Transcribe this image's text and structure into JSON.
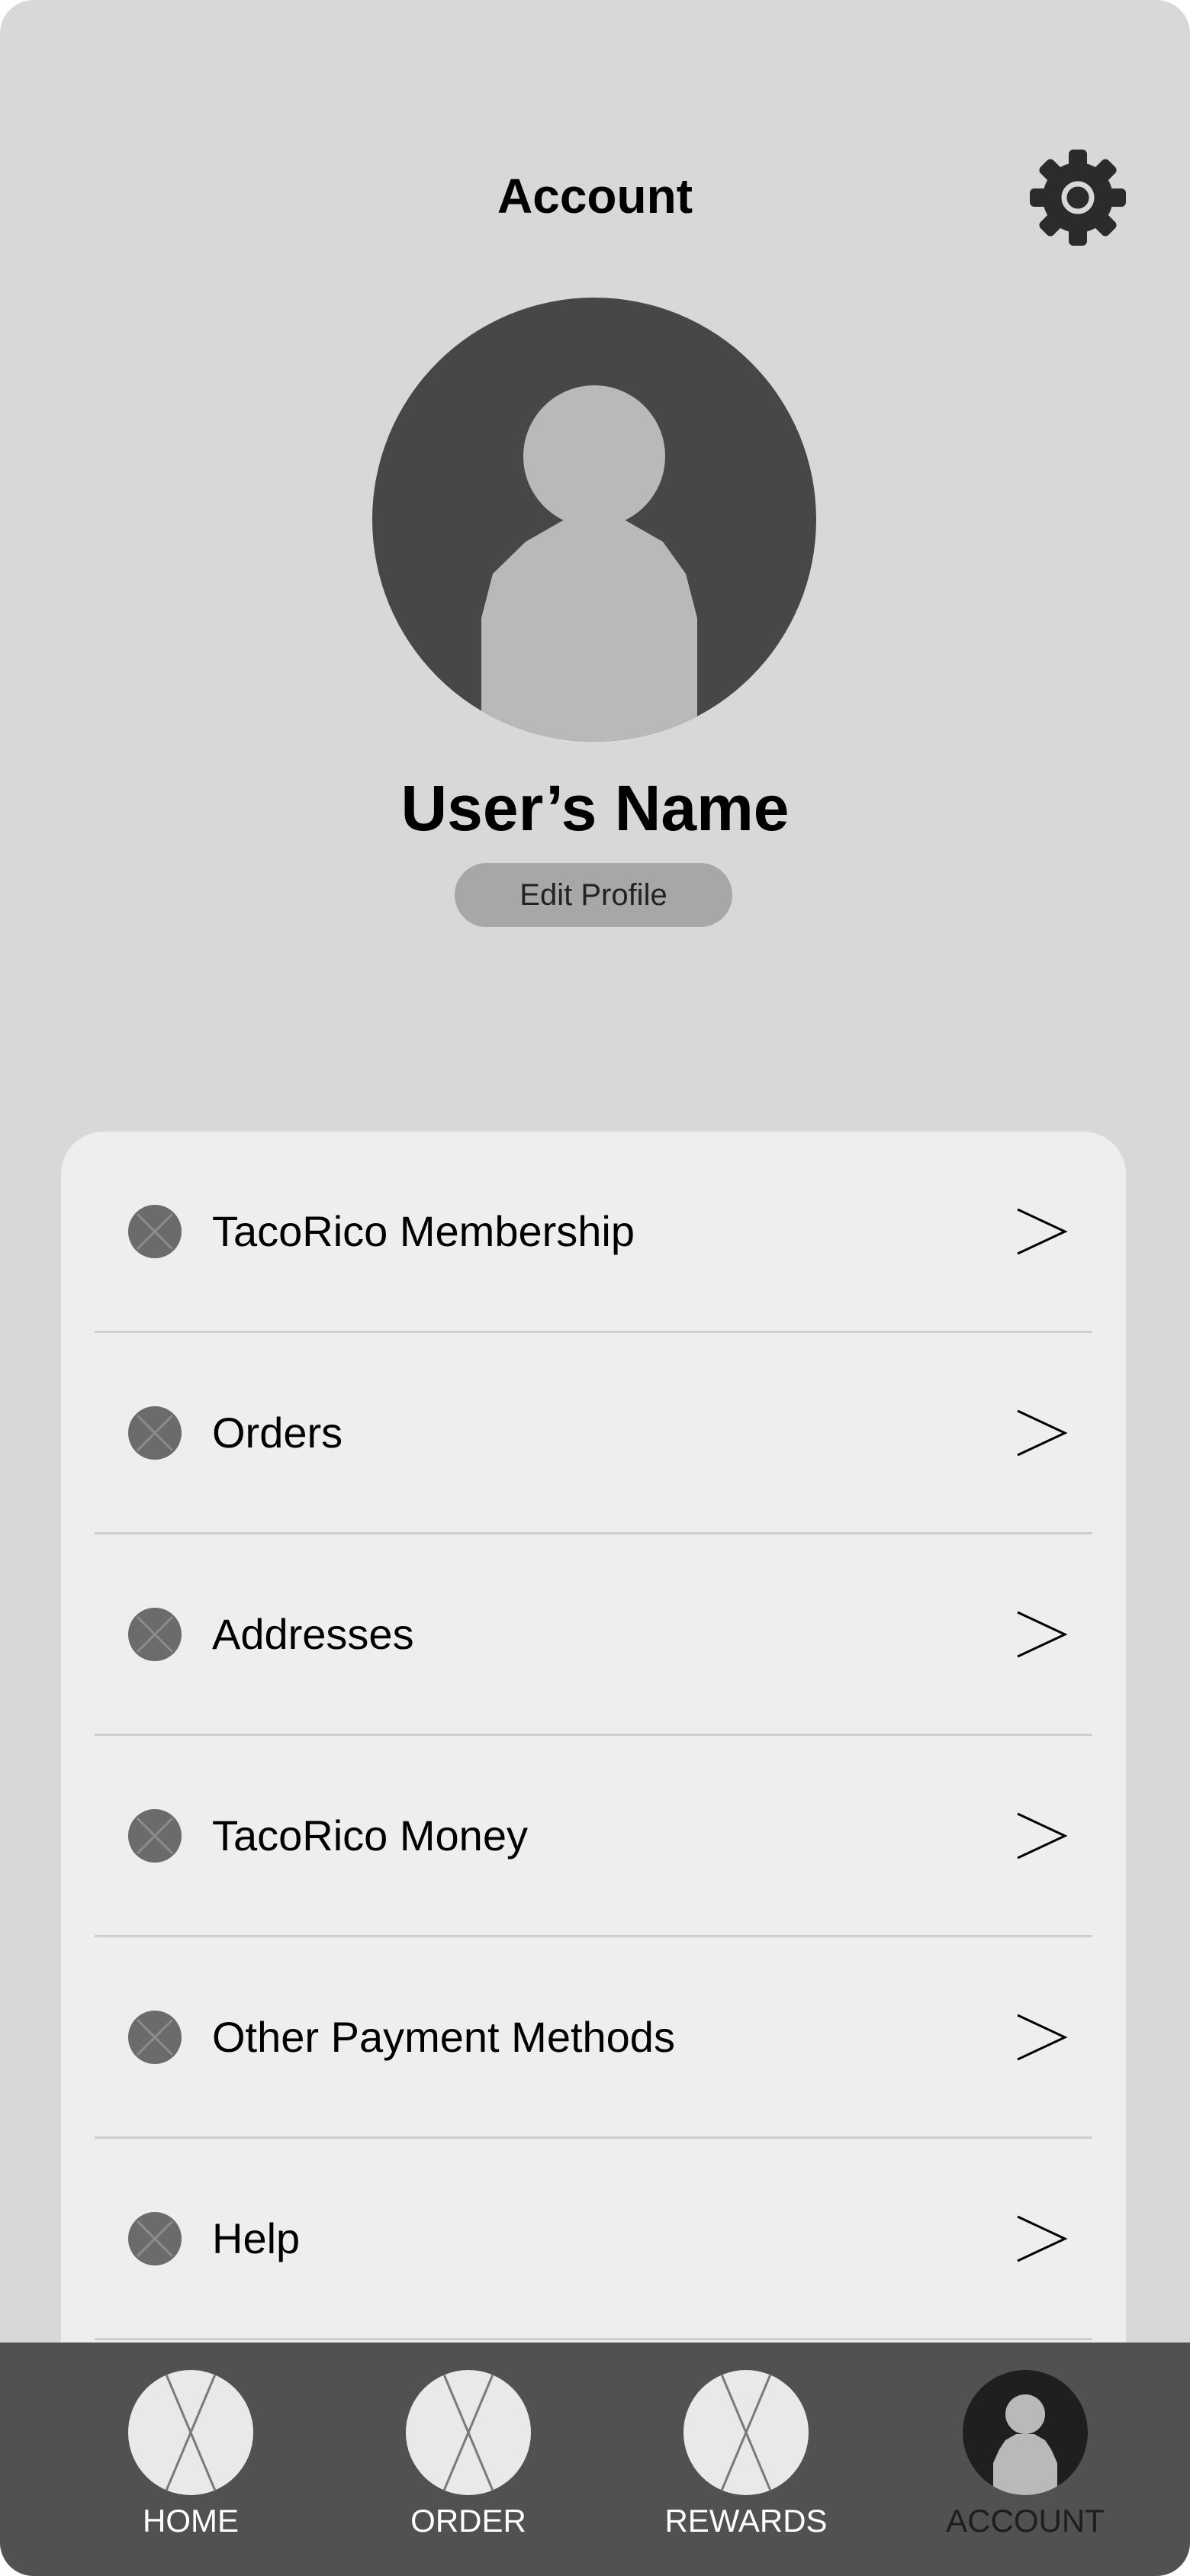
{
  "header": {
    "title": "Account",
    "settings_icon": "gear-icon"
  },
  "profile": {
    "avatar_icon": "user-avatar-icon",
    "name": "User’s Name",
    "edit_label": "Edit Profile"
  },
  "menu": {
    "items": [
      {
        "label": "TacoRico Membership",
        "icon": "placeholder-x-icon"
      },
      {
        "label": "Orders",
        "icon": "placeholder-x-icon"
      },
      {
        "label": "Addresses",
        "icon": "placeholder-x-icon"
      },
      {
        "label": "TacoRico Money",
        "icon": "placeholder-x-icon"
      },
      {
        "label": "Other Payment Methods",
        "icon": "placeholder-x-icon"
      },
      {
        "label": "Help",
        "icon": "placeholder-x-icon"
      }
    ],
    "chevron_icon": "chevron-right-icon"
  },
  "bottom_nav": {
    "items": [
      {
        "label": "HOME",
        "icon": "placeholder-image-icon"
      },
      {
        "label": "ORDER",
        "icon": "placeholder-image-icon"
      },
      {
        "label": "REWARDS",
        "icon": "placeholder-image-icon"
      },
      {
        "label": "ACCOUNT",
        "icon": "user-icon"
      }
    ],
    "active": "ACCOUNT"
  },
  "colors": {
    "background": "#d8d8d8",
    "card": "#eeeeee",
    "avatar_dark": "#474747",
    "avatar_light": "#b9b9b9",
    "nav_bar": "#515151",
    "button": "#a7a7a7"
  }
}
